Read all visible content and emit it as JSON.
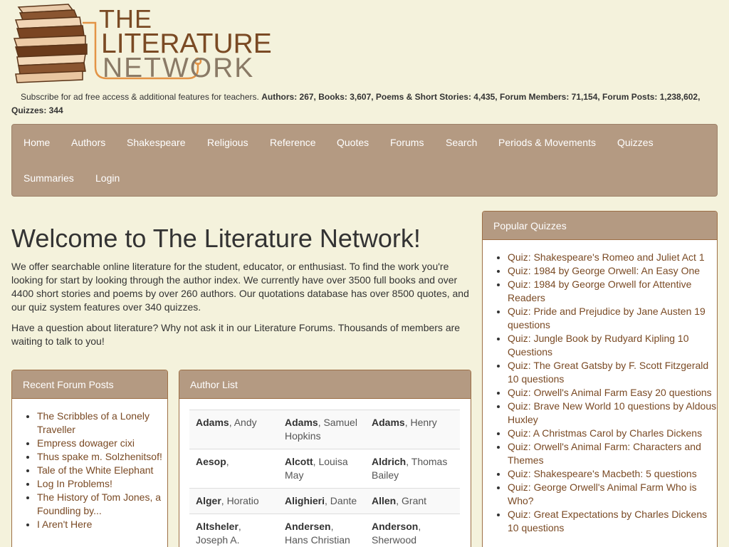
{
  "logo": {
    "line1": "THE",
    "line2": "LITERATURE",
    "line3": "NETWORK"
  },
  "stats": {
    "subscribe_text": "Subscribe for ad free access & additional features for teachers.",
    "summary": "Authors: 267, Books: 3,607, Poems & Short Stories: 4,435, Forum Members: 71,154, Forum Posts: 1,238,602, Quizzes: 344"
  },
  "nav": {
    "items": [
      "Home",
      "Authors",
      "Shakespeare",
      "Religious",
      "Reference",
      "Quotes",
      "Forums",
      "Search",
      "Periods & Movements",
      "Quizzes",
      "Summaries",
      "Login"
    ]
  },
  "welcome": {
    "title": "Welcome to The Literature Network!",
    "p1": "We offer searchable online literature for the student, educator, or enthusiast. To find the work you're looking for start by looking through the author index. We currently have over 3500 full books and over 4400 short stories and poems by over 260 authors. Our quotations database has over 8500 quotes, and our quiz system features over 340 quizzes.",
    "p2": "Have a question about literature? Why not ask it in our Literature Forums. Thousands of members are waiting to talk to you!"
  },
  "recent_posts": {
    "title": "Recent Forum Posts",
    "items": [
      "The Scribbles of a Lonely Traveller",
      "Empress dowager cixi",
      "Thus spake m. Solzhenitsof!",
      "Tale of the White Elephant",
      "Log In Problems!",
      "The History of Tom Jones, a Foundling by...",
      "I Aren't Here"
    ]
  },
  "author_list": {
    "title": "Author List",
    "rows": [
      [
        {
          "last": "Adams",
          "first": ", Andy"
        },
        {
          "last": "Adams",
          "first": ", Samuel Hopkins"
        },
        {
          "last": "Adams",
          "first": ", Henry"
        }
      ],
      [
        {
          "last": "Aesop",
          "first": ","
        },
        {
          "last": "Alcott",
          "first": ", Louisa May"
        },
        {
          "last": "Aldrich",
          "first": ", Thomas Bailey"
        }
      ],
      [
        {
          "last": "Alger",
          "first": ", Horatio"
        },
        {
          "last": "Alighieri",
          "first": ", Dante"
        },
        {
          "last": "Allen",
          "first": ", Grant"
        }
      ],
      [
        {
          "last": "Altsheler",
          "first": ", Joseph A."
        },
        {
          "last": "Andersen",
          "first": ", Hans Christian"
        },
        {
          "last": "Anderson",
          "first": ", Sherwood"
        }
      ]
    ]
  },
  "popular_quizzes": {
    "title": "Popular Quizzes",
    "items": [
      "Quiz: Shakespeare's Romeo and Juliet Act 1",
      "Quiz: 1984 by George Orwell: An Easy One",
      "Quiz: 1984 by George Orwell for Attentive Readers",
      "Quiz: Pride and Prejudice by Jane Austen 19 questions",
      "Quiz: Jungle Book by Rudyard Kipling 10 Questions",
      "Quiz: The Great Gatsby by F. Scott Fitzgerald 10 questions",
      "Quiz: Orwell's Animal Farm Easy 20 questions",
      "Quiz: Brave New World 10 questions by Aldous Huxley",
      "Quiz: A Christmas Carol by Charles Dickens",
      "Quiz: Orwell's Animal Farm: Characters and Themes",
      "Quiz: Shakespeare's Macbeth: 5 questions",
      "Quiz: George Orwell's Animal Farm Who is Who?",
      "Quiz: Great Expectations by Charles Dickens 10 questions"
    ]
  },
  "colors": {
    "background": "#f4f2dc",
    "nav_bg": "#b49a82",
    "brand_brown": "#7a4a24"
  }
}
